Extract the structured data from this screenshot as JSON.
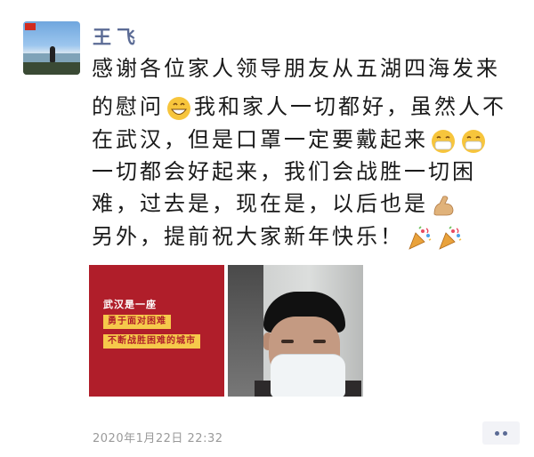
{
  "post": {
    "author": "王飞",
    "lines": [
      "感谢各位家人领导朋友从五湖四海发来",
      "的慰问",
      "我和家人一切都好，虽然人不",
      "在武汉，但是口罩一定要戴起来",
      "一切都会好起来，我们会战胜一切困",
      "难，过去是，现在是，以后也是",
      "另外，提前祝大家新年快乐！"
    ],
    "emoji": {
      "grin": "grin-emoji",
      "mask": "mask-emoji",
      "muscle": "flexed-biceps-emoji",
      "party": "party-popper-emoji"
    },
    "timestamp": "2020年1月22日  22:32"
  },
  "images": [
    {
      "headline": "武汉是一座",
      "line1": "勇于面对困难",
      "line2": "不断战胜困难的城市"
    },
    {
      "subject": "man-wearing-mask"
    }
  ],
  "actions": {
    "more_icon": "more-dots-icon"
  },
  "colors": {
    "name": "#5b6b95",
    "poster_red": "#b01e2a",
    "poster_yellow": "#f6c94b",
    "timestamp": "#9a9a9a"
  }
}
